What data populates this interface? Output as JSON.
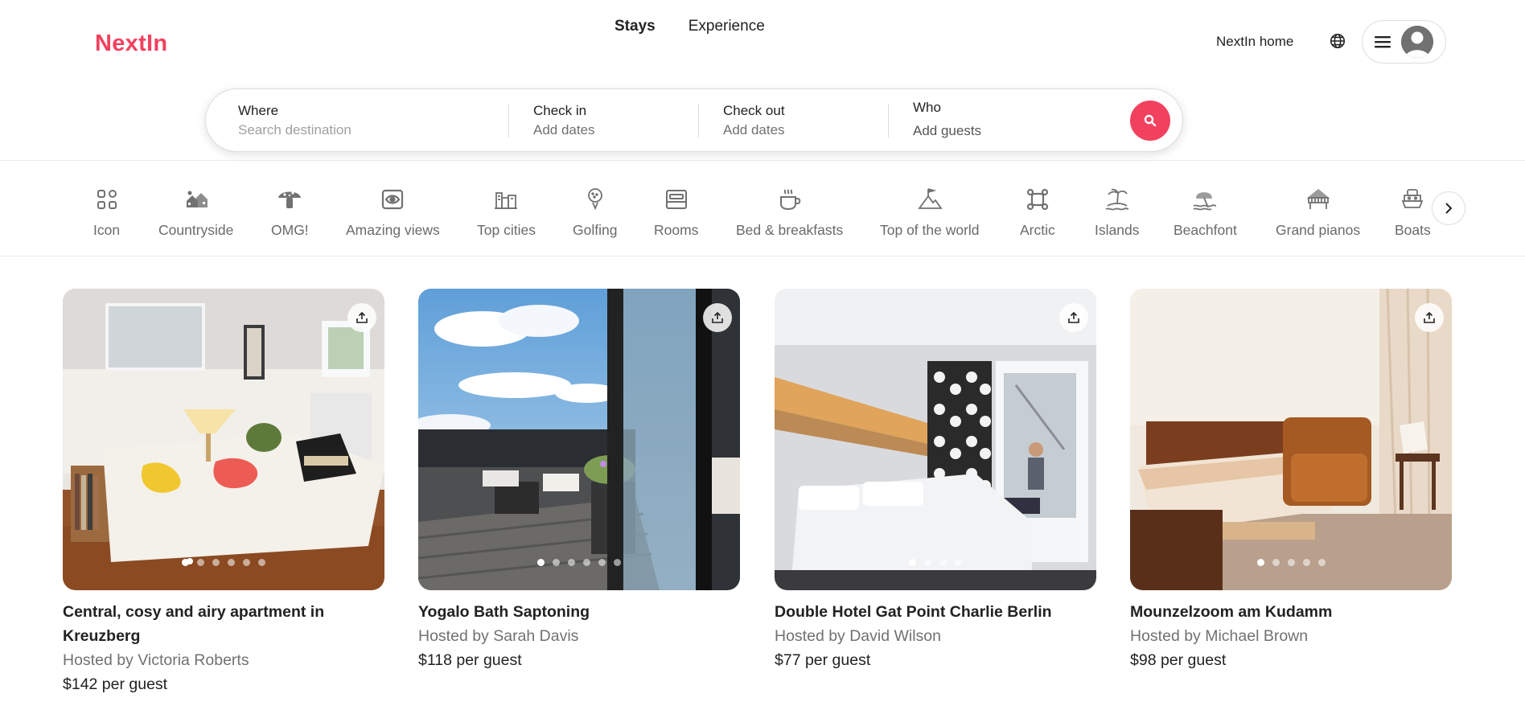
{
  "brand": {
    "logo": "NextIn",
    "accent": "#f2415f"
  },
  "nav": {
    "tabs": [
      {
        "label": "Stays",
        "active": true
      },
      {
        "label": "Experience",
        "active": false
      }
    ]
  },
  "header": {
    "host_link": "NextIn home",
    "globe_icon": "globe-icon",
    "menu_icon": "menu-icon",
    "avatar_icon": "user-avatar-icon"
  },
  "search": {
    "where": {
      "label": "Where",
      "placeholder": "Search destination"
    },
    "checkin": {
      "label": "Check in",
      "value": "Add dates"
    },
    "checkout": {
      "label": "Check out",
      "value": "Add dates"
    },
    "who": {
      "label": "Who",
      "value": "Add guests"
    },
    "button_icon": "search-icon"
  },
  "categories": [
    {
      "label": "Icon",
      "icon": "grid-icon"
    },
    {
      "label": "Countryside",
      "icon": "countryside-icon"
    },
    {
      "label": "OMG!",
      "icon": "mushroom-house-icon"
    },
    {
      "label": "Amazing views",
      "icon": "views-icon"
    },
    {
      "label": "Top cities",
      "icon": "city-icon"
    },
    {
      "label": "Golfing",
      "icon": "golf-icon"
    },
    {
      "label": "Rooms",
      "icon": "bed-icon"
    },
    {
      "label": "Bed & breakfasts",
      "icon": "coffee-cup-icon"
    },
    {
      "label": "Top of the world",
      "icon": "mountain-flag-icon"
    },
    {
      "label": "Arctic",
      "icon": "arctic-icon"
    },
    {
      "label": "Islands",
      "icon": "island-icon"
    },
    {
      "label": "Beachfont",
      "icon": "beach-icon"
    },
    {
      "label": "Grand pianos",
      "icon": "piano-icon"
    },
    {
      "label": "Boats",
      "icon": "boat-icon"
    }
  ],
  "listings": [
    {
      "title": "Central, cosy and airy apartment in Kreuzberg",
      "host": "Hosted by Victoria Roberts",
      "price": "$142 per guest",
      "photos": 6,
      "active_photo": 1
    },
    {
      "title": "Yogalo Bath Saptoning",
      "host": "Hosted by Sarah Davis",
      "price": "$118 per guest",
      "photos": 6,
      "active_photo": 1
    },
    {
      "title": "Double Hotel Gat Point Charlie Berlin",
      "host": "Hosted by David Wilson",
      "price": "$77 per guest",
      "photos": 4,
      "active_photo": 1
    },
    {
      "title": "Mounzelzoom am Kudamm",
      "host": "Hosted by Michael Brown",
      "price": "$98 per guest",
      "photos": 5,
      "active_photo": 1
    }
  ]
}
